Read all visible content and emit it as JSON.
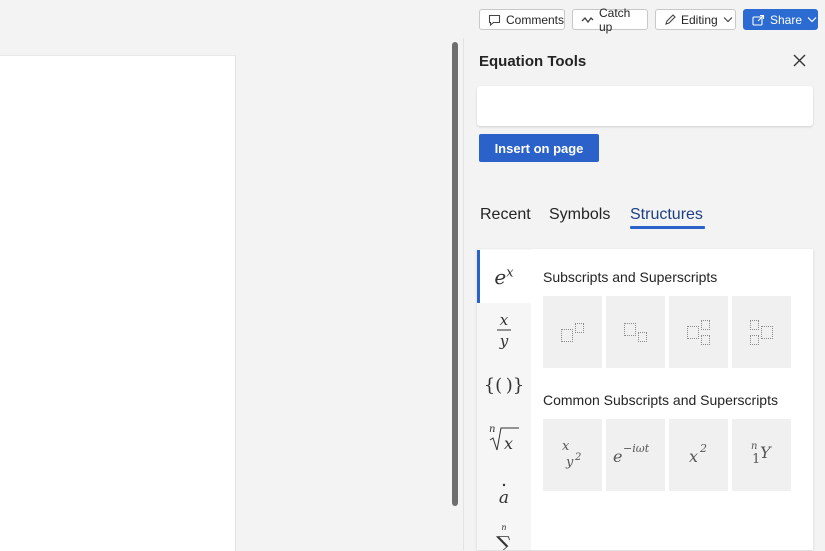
{
  "toolbar": {
    "comments_label": "Comments",
    "catchup_label": "Catch up",
    "editing_label": "Editing",
    "share_label": "Share",
    "accent_color": "#2b6bd2"
  },
  "pane": {
    "title": "Equation Tools",
    "insert_label": "Insert on page",
    "tabs": [
      {
        "label": "Recent",
        "active": false
      },
      {
        "label": "Symbols",
        "active": false
      },
      {
        "label": "Structures",
        "active": true
      }
    ],
    "categories": [
      {
        "name": "scripts",
        "icon": "superscript-icon"
      },
      {
        "name": "fraction",
        "icon": "fraction-icon"
      },
      {
        "name": "brackets",
        "icon": "brackets-icon"
      },
      {
        "name": "radical",
        "icon": "radical-icon"
      },
      {
        "name": "accent",
        "icon": "accent-icon"
      },
      {
        "name": "large-operator",
        "icon": "summation-icon"
      }
    ],
    "sections": [
      {
        "heading": "Subscripts and Superscripts"
      },
      {
        "heading": "Common Subscripts and Superscripts"
      }
    ]
  }
}
